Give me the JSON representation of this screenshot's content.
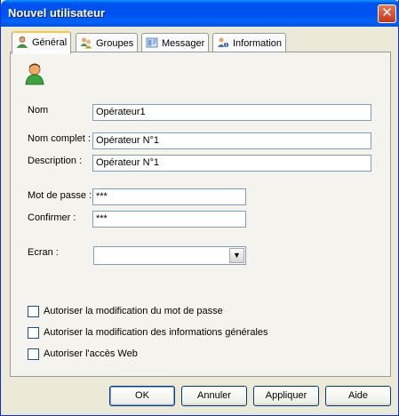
{
  "window": {
    "title": "Nouvel utilisateur",
    "close_glyph": "✕"
  },
  "tabs": [
    {
      "label": "Général",
      "icon": "user-icon",
      "active": true
    },
    {
      "label": "Groupes",
      "icon": "group-icon",
      "active": false
    },
    {
      "label": "Messager",
      "icon": "messenger-icon",
      "active": false
    },
    {
      "label": "Information",
      "icon": "info-icon",
      "active": false
    }
  ],
  "form": {
    "nom": {
      "label": "Nom",
      "value": "Opérateur1"
    },
    "nom_complet": {
      "label": "Nom complet :",
      "value": "Opérateur N°1"
    },
    "description": {
      "label": "Description :",
      "value": "Opérateur N°1"
    },
    "mot_de_passe": {
      "label": "Mot de passe :",
      "value": "***"
    },
    "confirmer": {
      "label": "Confirmer :",
      "value": "***"
    },
    "ecran": {
      "label": "Ecran :",
      "value": ""
    }
  },
  "options": [
    {
      "label": "Autoriser la modification du mot de passe",
      "checked": false
    },
    {
      "label": "Autoriser la modification des informations générales",
      "checked": false
    },
    {
      "label": "Autoriser l'accès Web",
      "checked": false
    }
  ],
  "buttons": {
    "ok": "OK",
    "annuler": "Annuler",
    "appliquer": "Appliquer",
    "aide": "Aide"
  },
  "colors": {
    "title_bar": "#0054e3",
    "tab_highlight": "#ffc83c",
    "window_bg": "#ece9d8"
  }
}
